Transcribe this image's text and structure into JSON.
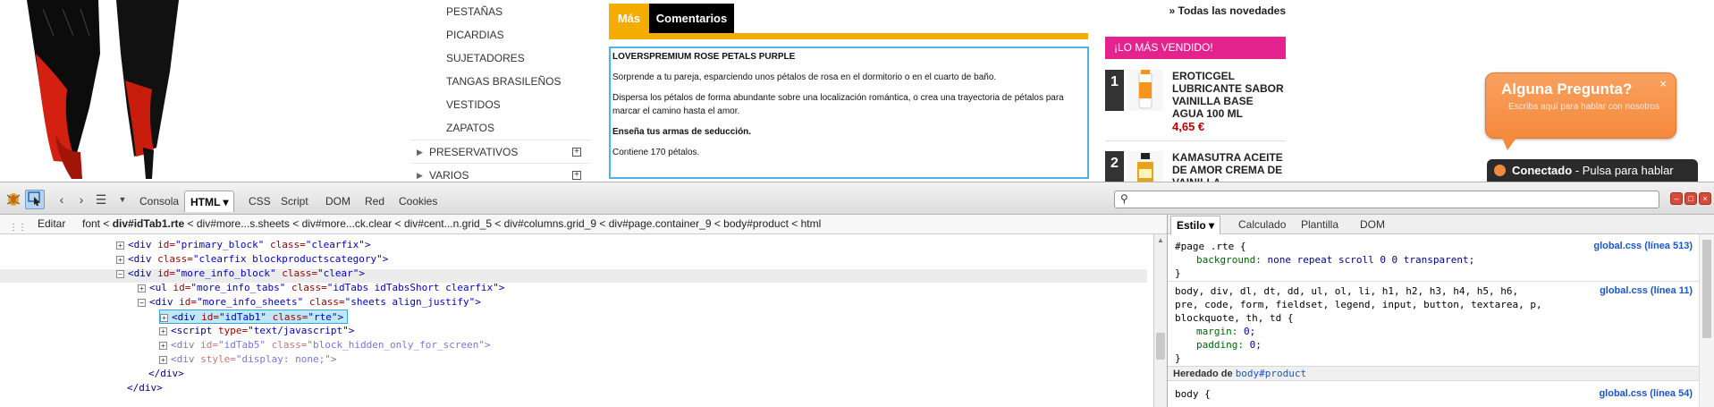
{
  "catnav": {
    "subitems": [
      "PESTAÑAS",
      "PICARDIAS",
      "SUJETADORES",
      "TANGAS BRASILEÑOS",
      "VESTIDOS",
      "ZAPATOS"
    ],
    "main_items": [
      "PRESERVATIVOS",
      "VARIOS"
    ],
    "plus": "+"
  },
  "tabs": {
    "mas": "Más",
    "comentarios": "Comentarios"
  },
  "product": {
    "title": "LOVERSPREMIUM ROSE PETALS PURPLE",
    "p1": "Sorprende a tu pareja, esparciendo unos pétalos de rosa en el dormitorio o en el cuarto de baño.",
    "p2": "Dispersa los pétalos de forma abundante sobre una localización romántica, o crea una trayectoria de pétalos para marcar el camino hasta el amor.",
    "p3": "Enseña tus armas de seducción.",
    "p4": "Contiene 170 pétalos."
  },
  "sidebar": {
    "news_link": "» Todas las novedades",
    "bestseller_head": "¡LO MÁS VENDIDO!",
    "items": [
      {
        "num": "1",
        "title": "EROTICGEL LUBRICANTE SABOR VAINILLA BASE AGUA 100 ML",
        "price": "4,65 €"
      },
      {
        "num": "2",
        "title": "KAMASUTRA ACEITE DE AMOR CREMA DE VAINILLA",
        "price": ""
      }
    ]
  },
  "chat": {
    "question": "Alguna Pregunta?",
    "hint": "Escriba aquí para hablar con nosotros",
    "close": "×",
    "status_bold": "Conectado",
    "status_rest": " - Pulsa para hablar"
  },
  "toolbar": {
    "tabs": [
      "Consola",
      "HTML",
      "CSS",
      "Script",
      "DOM",
      "Red",
      "Cookies"
    ],
    "html_caret": "▾"
  },
  "crumbs": {
    "edit": "Editar",
    "path_pre": "font < ",
    "path_bold": "div#idTab1.rte",
    "path_post": " < div#more...s.sheets < div#more...ck.clear < div#cent...n.grid_5 < div#columns.grid_9 < div#page.container_9 < body#product < html"
  },
  "tree": [
    {
      "ind": 130,
      "tw": "+",
      "tag": "<div",
      "attrs": [
        [
          "id",
          "primary_block"
        ],
        [
          "class",
          "clearfix"
        ]
      ],
      "end": ">"
    },
    {
      "ind": 130,
      "tw": "+",
      "tag": "<div",
      "attrs": [
        [
          "class",
          "clearfix blockproductscategory"
        ]
      ],
      "end": ">"
    },
    {
      "ind": 130,
      "tw": "−",
      "tag": "<div",
      "attrs": [
        [
          "id",
          "more_info_block"
        ],
        [
          "class",
          "clear"
        ]
      ],
      "end": ">"
    },
    {
      "ind": 154,
      "tw": "+",
      "tag": "<ul",
      "attrs": [
        [
          "id",
          "more_info_tabs"
        ],
        [
          "class",
          "idTabs idTabsShort clearfix"
        ]
      ],
      "end": ">"
    },
    {
      "ind": 154,
      "tw": "−",
      "tag": "<div",
      "attrs": [
        [
          "id",
          "more_info_sheets"
        ],
        [
          "class",
          "sheets align_justify"
        ]
      ],
      "end": ">"
    },
    {
      "ind": 178,
      "tw": "+",
      "tag": "<div",
      "attrs": [
        [
          "id",
          "idTab1"
        ],
        [
          "class",
          "rte"
        ]
      ],
      "end": ">",
      "sel": true
    },
    {
      "ind": 178,
      "tw": "+",
      "tag": "<script",
      "attrs": [
        [
          "type",
          "text/javascript"
        ]
      ],
      "end": ">"
    },
    {
      "ind": 178,
      "tw": "+",
      "tag": "<div",
      "attrs": [
        [
          "id",
          "idTab5"
        ],
        [
          "class",
          "block_hidden_only_for_screen"
        ]
      ],
      "end": ">",
      "dim": true
    },
    {
      "ind": 178,
      "tw": "+",
      "tag": "<div",
      "attrs": [
        [
          "style",
          "display: none;"
        ]
      ],
      "end": ">",
      "dim": true
    },
    {
      "ind": 166,
      "tw": "",
      "tag": "</div>",
      "attrs": [],
      "end": ""
    },
    {
      "ind": 142,
      "tw": "",
      "tag": "</div>",
      "attrs": [],
      "end": ""
    }
  ],
  "side": {
    "tabs": [
      "Estilo",
      "Calculado",
      "Plantilla",
      "DOM"
    ],
    "rule1_sel": "#page .rte {",
    "rule1_prop": "background:",
    "rule1_val": "none repeat scroll 0 0 transparent;",
    "rule1_src": "global.css (línea 513)",
    "rule2_sel1": "body, div, dl, dt, dd, ul, ol, li, h1, h2, h3, h4, h5, h6,",
    "rule2_sel2": "pre, code, form, fieldset, legend, input, button, textarea, p,",
    "rule2_sel3": "blockquote, th, td {",
    "rule2_p1": "margin:",
    "rule2_v1": "0;",
    "rule2_p2": "padding:",
    "rule2_v2": "0;",
    "rule2_src": "global.css (línea 11)",
    "close_brace": "}",
    "inherited_label": "Heredado de ",
    "inherited_link": "body#product",
    "rule3_sel": "body {",
    "rule3_src": "global.css (línea 54)"
  },
  "colors": {
    "accent_orange": "#f4ac00",
    "bestseller_pink": "#e4238f",
    "price_red": "#c20000",
    "chat_orange": "#f58a3c"
  }
}
